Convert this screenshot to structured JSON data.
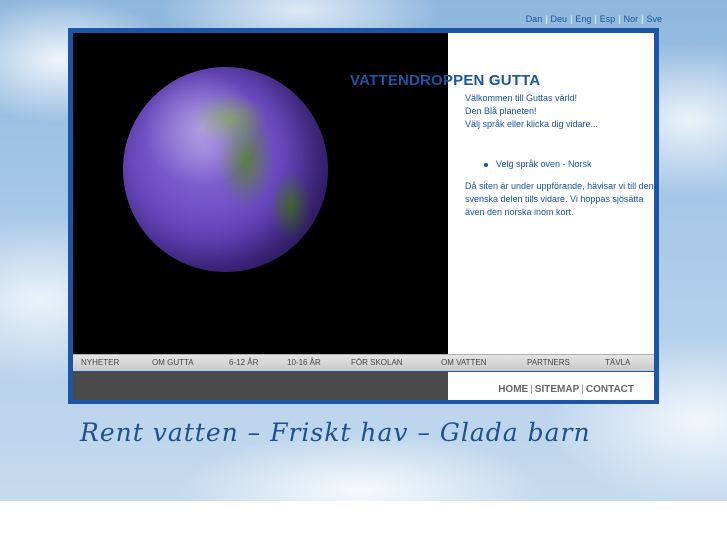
{
  "languages": [
    {
      "label": "Dan"
    },
    {
      "label": "Deu"
    },
    {
      "label": "Eng"
    },
    {
      "label": "Esp"
    },
    {
      "label": "Nor"
    },
    {
      "label": "Sve"
    }
  ],
  "lang_separator": "|",
  "site_title": "VATTENDROPPEN GUTTA",
  "intro": {
    "line1": "Välkommen till Guttas värld!",
    "line2": "Den Blå planeten!",
    "line3": "Välj språk eller klicka dig vidare..."
  },
  "bullet": "Velg språk oven - Norsk",
  "note": "Då siten är under uppförande, hävisar vi till den svenska delen tills vidare. Vi hoppas sjösätta även den norska inom kort.",
  "nav": [
    {
      "label": "NYHETER"
    },
    {
      "label": "OM GUTTA"
    },
    {
      "label": "6-12 ÅR"
    },
    {
      "label": "10-16 ÅR"
    },
    {
      "label": "FÖR SKOLAN"
    },
    {
      "label": "OM VATTEN"
    },
    {
      "label": "PARTNERS"
    },
    {
      "label": "TÄVLA"
    }
  ],
  "footer": {
    "home": "HOME",
    "sitemap": "SITEMAP",
    "contact": "CONTACT",
    "separator": "|"
  },
  "slogan": "Rent vatten – Friskt hav – Glada barn",
  "colors": {
    "accent": "#1a55a6",
    "frame": "#1a55a6",
    "nav_bg": "#d6d6d6",
    "footer_dark": "#4a4a4a"
  }
}
